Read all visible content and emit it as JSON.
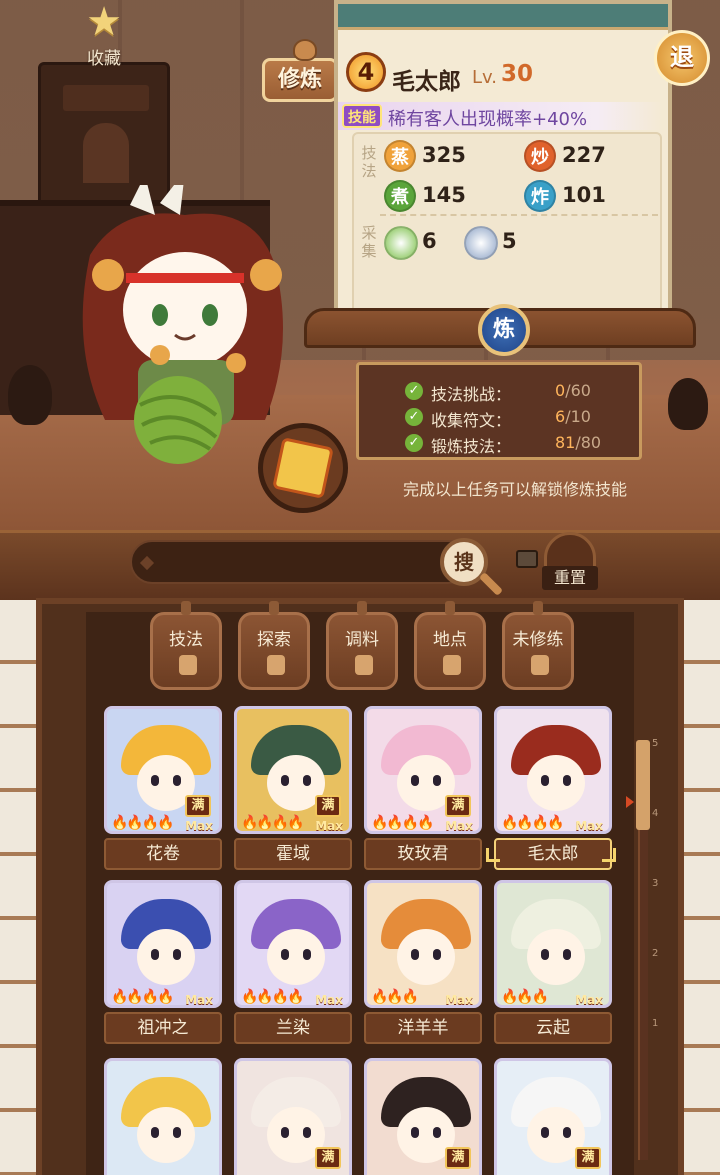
{
  "favorites": {
    "label": "收藏",
    "icon": "star-icon"
  },
  "practice_tab": {
    "label": "修炼"
  },
  "exit_button": {
    "label": "退"
  },
  "character": {
    "level": "4",
    "name": "毛太郎",
    "lv_prefix": "Lv.",
    "lv_value": "30",
    "skill_tag": "技能",
    "skill_desc": "稀有客人出现概率+40%"
  },
  "stats": {
    "technique_label": "技法",
    "gather_label": "采集",
    "techniques": [
      {
        "glyph": "蒸",
        "value": "325",
        "color": "#f0a23a"
      },
      {
        "glyph": "炒",
        "value": "227",
        "color": "#e0622c"
      },
      {
        "glyph": "煮",
        "value": "145",
        "color": "#5aa53a"
      },
      {
        "glyph": "炸",
        "value": "101",
        "color": "#3aa0c8"
      }
    ],
    "gather": [
      {
        "icon": "vegetable-icon",
        "value": "6",
        "color": "#7cc04a"
      },
      {
        "icon": "fish-icon",
        "value": "5",
        "color": "#8ea4c6"
      }
    ]
  },
  "refine_button": {
    "label": "炼"
  },
  "tasks": [
    {
      "label": "技法挑战：",
      "current": "0",
      "max": "/60"
    },
    {
      "label": "收集符文：",
      "current": "6",
      "max": "/10"
    },
    {
      "label": "锻炼技法：",
      "current": "81",
      "max": "/80"
    }
  ],
  "task_hint": "完成以上任务可以解锁修炼技能",
  "search": {
    "button": "搜",
    "placeholder": ""
  },
  "reset_button": {
    "label": "重置"
  },
  "filters": [
    {
      "label": "技法"
    },
    {
      "label": "探索"
    },
    {
      "label": "调料"
    },
    {
      "label": "地点"
    },
    {
      "label": "未修练"
    }
  ],
  "badges": {
    "max": "Max",
    "full": "满"
  },
  "roster": [
    {
      "name": "花卷",
      "flames": "🔥🔥🔥🔥",
      "full": true,
      "max": true,
      "hair": "#f3b73a",
      "bg": "#c9d6f2"
    },
    {
      "name": "霍域",
      "flames": "🔥🔥🔥🔥",
      "full": true,
      "max": true,
      "hair": "#3a5a44",
      "bg": "#e8c060"
    },
    {
      "name": "玫玫君",
      "flames": "🔥🔥🔥🔥",
      "full": true,
      "max": true,
      "hair": "#f2b9d2",
      "bg": "#f3dbe8"
    },
    {
      "name": "毛太郎",
      "flames": "🔥🔥🔥🔥",
      "full": false,
      "max": true,
      "hair": "#9a2c1e",
      "bg": "#f0e2ee",
      "selected": true
    },
    {
      "name": "祖冲之",
      "flames": "🔥🔥🔥🔥",
      "full": false,
      "max": true,
      "hair": "#3b4fb0",
      "bg": "#d9d2f2"
    },
    {
      "name": "兰染",
      "flames": "🔥🔥🔥🔥",
      "full": false,
      "max": true,
      "hair": "#8a64c8",
      "bg": "#e2d8f4"
    },
    {
      "name": "洋羊羊",
      "flames": "🔥🔥🔥",
      "full": false,
      "max": true,
      "hair": "#e58c3a",
      "bg": "#f6e1c4"
    },
    {
      "name": "云起",
      "flames": "🔥🔥🔥",
      "full": false,
      "max": true,
      "hair": "#eef0e0",
      "bg": "#dfe7d4"
    },
    {
      "name": "",
      "flames": "",
      "full": false,
      "max": false,
      "hair": "#f2c54a",
      "bg": "#dce8f4"
    },
    {
      "name": "",
      "flames": "",
      "full": true,
      "max": false,
      "hair": "#f4ece6",
      "bg": "#f0e4e0"
    },
    {
      "name": "",
      "flames": "",
      "full": true,
      "max": false,
      "hair": "#2e2220",
      "bg": "#f2dcd0"
    },
    {
      "name": "",
      "flames": "",
      "full": true,
      "max": false,
      "hair": "#f6f6f6",
      "bg": "#e6eef6"
    }
  ],
  "scroll_ticks": [
    "5",
    "4",
    "3",
    "2",
    "1"
  ],
  "colors": {
    "accent": "#d1692a",
    "panel": "#5c3423",
    "card": "#f4ead4"
  }
}
